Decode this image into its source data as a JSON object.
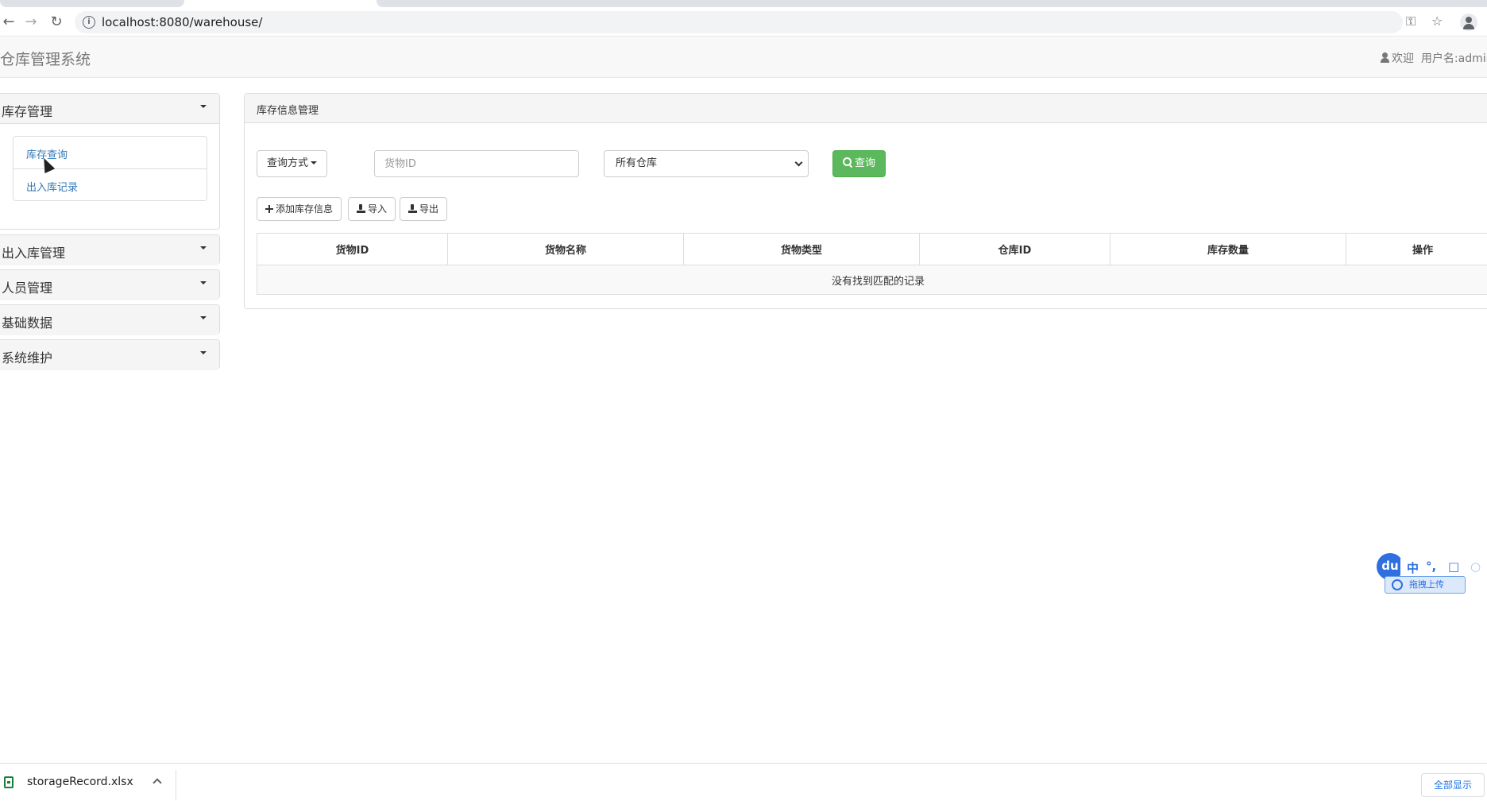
{
  "browser": {
    "url": "localhost:8080/warehouse/"
  },
  "navbar": {
    "brand": "仓库管理系统",
    "welcome": "欢迎",
    "username": "用户名:admin"
  },
  "sidebar": {
    "inventory": {
      "title": "库存管理",
      "items": [
        "库存查询",
        "出入库记录"
      ]
    },
    "collapsed": [
      "出入库管理",
      "人员管理",
      "基础数据",
      "系统维护"
    ]
  },
  "main": {
    "title": "库存信息管理",
    "query_mode_label": "查询方式",
    "goods_id_placeholder": "货物ID",
    "warehouse_select": "所有仓库",
    "search_button": "查询",
    "add_button": "添加库存信息",
    "import_button": "导入",
    "export_button": "导出",
    "table": {
      "columns": [
        "货物ID",
        "货物名称",
        "货物类型",
        "仓库ID",
        "库存数量",
        "操作"
      ],
      "empty_message": "没有找到匹配的记录"
    }
  },
  "ime": {
    "logo": "du",
    "mode": "中",
    "punct": "°,",
    "upload_label": "拖拽上传"
  },
  "downloads": {
    "file_name": "storageRecord.xlsx",
    "show_all": "全部显示"
  }
}
